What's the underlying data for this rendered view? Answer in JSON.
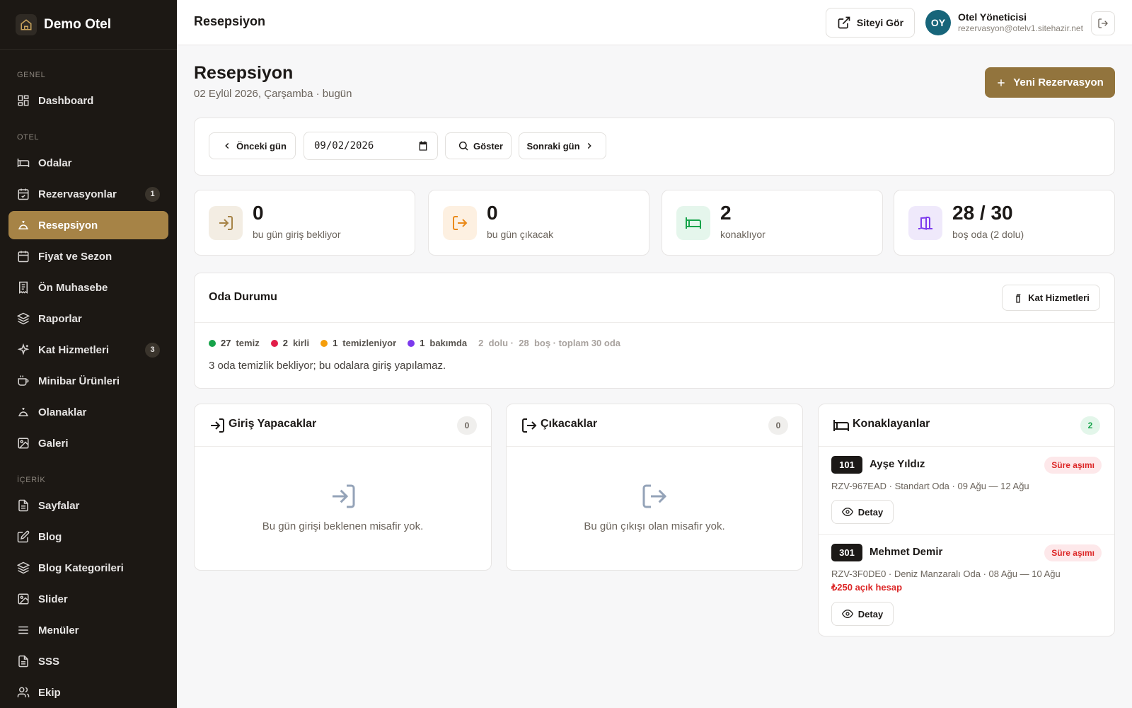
{
  "brand": {
    "name": "Demo Otel"
  },
  "sidebar": {
    "sections": [
      "GENEL",
      "OTEL",
      "İÇERİK"
    ],
    "items": [
      {
        "label": "Dashboard",
        "icon": "dashboard-icon"
      },
      {
        "label": "Odalar",
        "icon": "bed-icon"
      },
      {
        "label": "Rezervasyonlar",
        "icon": "calendar-check-icon",
        "badge": "1"
      },
      {
        "label": "Resepsiyon",
        "icon": "bell-icon",
        "active": true
      },
      {
        "label": "Fiyat ve Sezon",
        "icon": "calendar-icon"
      },
      {
        "label": "Ön Muhasebe",
        "icon": "receipt-icon"
      },
      {
        "label": "Raporlar",
        "icon": "layers-icon"
      },
      {
        "label": "Kat Hizmetleri",
        "icon": "sparkles-icon",
        "badge": "3"
      },
      {
        "label": "Minibar Ürünleri",
        "icon": "cup-icon"
      },
      {
        "label": "Olanaklar",
        "icon": "bell-icon"
      },
      {
        "label": "Galeri",
        "icon": "image-icon"
      },
      {
        "label": "Sayfalar",
        "icon": "file-icon"
      },
      {
        "label": "Blog",
        "icon": "edit-icon"
      },
      {
        "label": "Blog Kategorileri",
        "icon": "layers-icon"
      },
      {
        "label": "Slider",
        "icon": "image-icon"
      },
      {
        "label": "Menüler",
        "icon": "menu-icon"
      },
      {
        "label": "SSS",
        "icon": "file-icon"
      },
      {
        "label": "Ekip",
        "icon": "users-icon"
      }
    ]
  },
  "topbar": {
    "title": "Resepsiyon",
    "site_button": "Siteyi Gör",
    "avatar_initials": "OY",
    "user_name": "Otel Yöneticisi",
    "user_email": "rezervasyon@otelv1.sitehazir.net"
  },
  "page": {
    "title": "Resepsiyon",
    "subtitle": "02 Eylül 2026, Çarşamba · bugün",
    "new_button": "Yeni Rezervasyon"
  },
  "date_nav": {
    "prev": "Önceki gün",
    "date_value": "09/02/2026",
    "show": "Göster",
    "next": "Sonraki gün"
  },
  "stats": [
    {
      "value": "0",
      "label": "bu gün giriş bekliyor",
      "color": "#a68346",
      "bg": "#f3ede3"
    },
    {
      "value": "0",
      "label": "bu gün çıkacak",
      "color": "#ea8a1a",
      "bg": "#fdf0e1"
    },
    {
      "value": "2",
      "label": "konaklıyor",
      "color": "#16a34a",
      "bg": "#e5f6ec"
    },
    {
      "value": "28 / 30",
      "label": "boş oda (2 dolu)",
      "color": "#7c3aed",
      "bg": "#efe9fb"
    }
  ],
  "room_status": {
    "title": "Oda Durumu",
    "button": "Kat Hizmetleri",
    "legend": [
      {
        "count": "27",
        "label": "temiz",
        "color": "#16a34a"
      },
      {
        "count": "2",
        "label": "kirli",
        "color": "#e11d48"
      },
      {
        "count": "1",
        "label": "temizleniyor",
        "color": "#f59e0b"
      },
      {
        "count": "1",
        "label": "bakımda",
        "color": "#7c3aed"
      }
    ],
    "dolu_count": "2",
    "dolu_label": "dolu ·",
    "bos_count": "28",
    "bos_label": "boş · toplam 30 oda",
    "note": "3 oda temizlik bekliyor; bu odalara giriş yapılamaz."
  },
  "arrivals": {
    "title": "Giriş Yapacaklar",
    "count": "0",
    "empty": "Bu gün girişi beklenen misafir yok."
  },
  "departures": {
    "title": "Çıkacaklar",
    "count": "0",
    "empty": "Bu gün çıkışı olan misafir yok."
  },
  "staying": {
    "title": "Konaklayanlar",
    "count": "2",
    "guests": [
      {
        "room": "101",
        "name": "Ayşe Yıldız",
        "status": "Süre aşımı",
        "meta": "RZV-967EAD · Standart Oda · 09 Ağu — 12 Ağu",
        "balance": "",
        "detail": "Detay"
      },
      {
        "room": "301",
        "name": "Mehmet Demir",
        "status": "Süre aşımı",
        "meta": "RZV-3F0DE0 · Deniz Manzaralı Oda · 08 Ağu — 10 Ağu",
        "balance": "₺250 açık hesap",
        "detail": "Detay"
      }
    ]
  }
}
